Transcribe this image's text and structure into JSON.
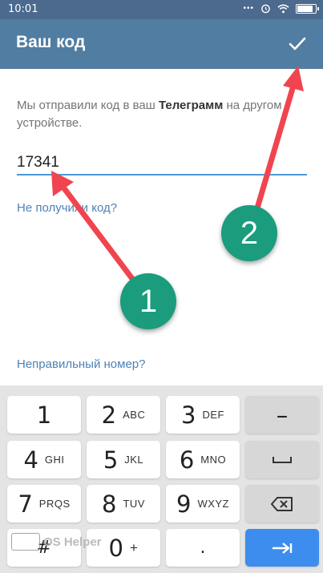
{
  "status_bar": {
    "time": "10:01"
  },
  "app_bar": {
    "title": "Ваш код"
  },
  "content": {
    "info_prefix": "Мы отправили код в ваш ",
    "info_bold": "Телеграмм",
    "info_suffix": " на другом устройстве.",
    "code_value": "17341",
    "no_code_link": "Не получили код?",
    "wrong_number_link": "Неправильный номер?"
  },
  "annotations": {
    "badge_1": "1",
    "badge_2": "2"
  },
  "keyboard": {
    "keys": [
      {
        "digit": "1",
        "letters": ""
      },
      {
        "digit": "2",
        "letters": "ABC"
      },
      {
        "digit": "3",
        "letters": "DEF"
      },
      {
        "digit": "4",
        "letters": "GHI"
      },
      {
        "digit": "5",
        "letters": "JKL"
      },
      {
        "digit": "6",
        "letters": "MNO"
      },
      {
        "digit": "7",
        "letters": "PRQS"
      },
      {
        "digit": "8",
        "letters": "TUV"
      },
      {
        "digit": "9",
        "letters": "WXYZ"
      },
      {
        "digit": "#",
        "letters": ""
      },
      {
        "digit": "0",
        "letters": "+"
      },
      {
        "digit": ".",
        "letters": ""
      }
    ],
    "minus": "–"
  },
  "watermark": {
    "text": "OS Helper"
  },
  "colors": {
    "app_bar": "#517da2",
    "status_bar": "#4b6a8e",
    "link": "#4d82b6",
    "input_underline": "#4e9ad8",
    "badge": "#1a9c7d",
    "arrow": "#f0454f",
    "enter_key": "#3c8dee"
  },
  "icons": [
    "checkmark-icon",
    "backspace-icon",
    "space-icon",
    "enter-arrow-icon",
    "wifi-icon",
    "alarm-icon",
    "battery-icon"
  ]
}
